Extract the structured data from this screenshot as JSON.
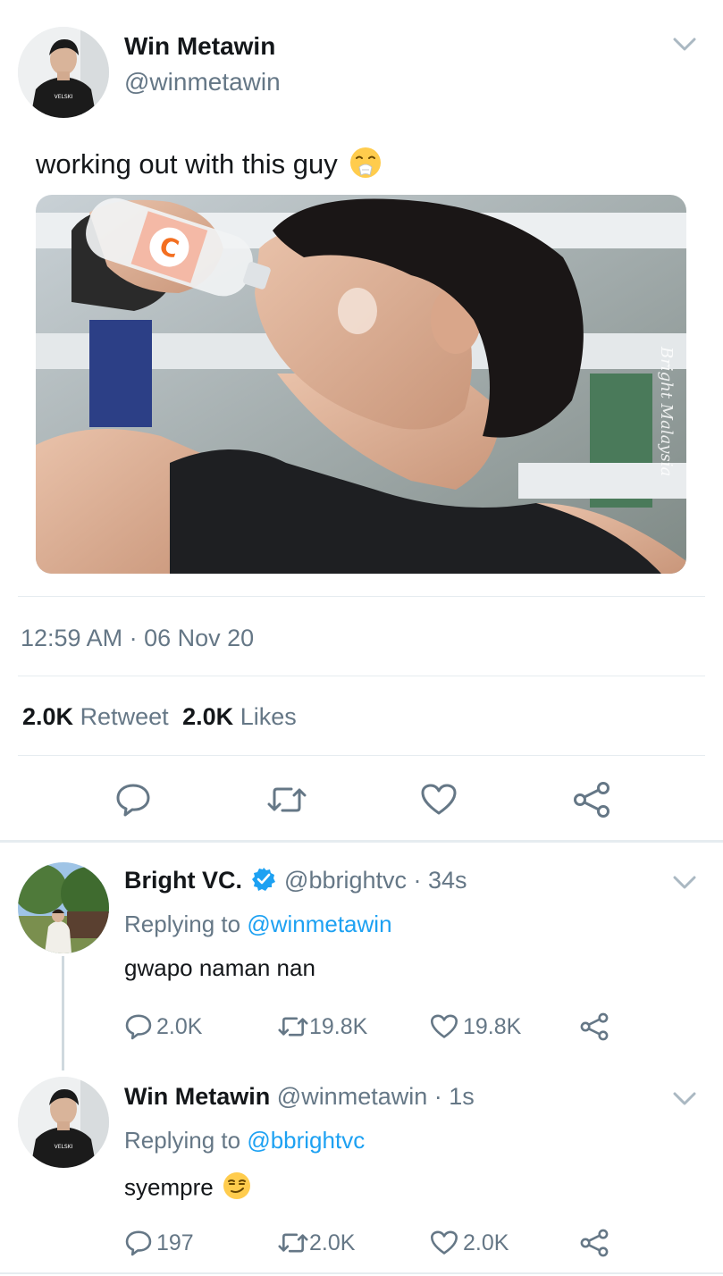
{
  "tweet": {
    "name": "Win Metawin",
    "handle": "@winmetawin",
    "text": "working out with this guy",
    "emoji_icon": "sneezing-face-emoji",
    "image_watermark": "Bright Malaysia",
    "bottle_label": "C",
    "avatar_shirt_text": "VELSKI",
    "timestamp": "12:59 AM · 06 Nov 20",
    "retweet_count": "2.0K",
    "retweet_label": "Retweet",
    "like_count": "2.0K",
    "like_label": "Likes"
  },
  "actions": [
    "reply-icon",
    "retweet-icon",
    "like-icon",
    "share-icon"
  ],
  "replies": [
    {
      "name": "Bright VC.",
      "verified": true,
      "handle": "@bbrightvc",
      "time": "· 34s",
      "replying_prefix": "Replying to",
      "replying_to": "@winmetawin",
      "text": "gwapo naman nan",
      "reply_count": "2.0K",
      "retweet_count": "19.8K",
      "like_count": "19.8K"
    },
    {
      "name": "Win Metawin",
      "verified": false,
      "handle": "@winmetawin",
      "time": "· 1s",
      "replying_prefix": "Replying to",
      "replying_to": "@bbrightvc",
      "text": "syempre",
      "emoji_icon": "smirking-face-emoji",
      "reply_count": "197",
      "retweet_count": "2.0K",
      "like_count": "2.0K"
    }
  ],
  "colors": {
    "accent": "#1da1f2",
    "secondary_text": "#657786",
    "divider": "#e6ecf0"
  }
}
